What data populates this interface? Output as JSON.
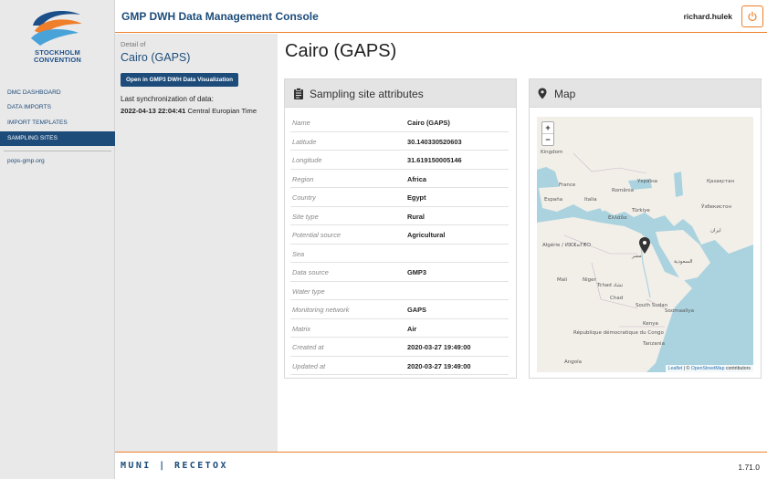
{
  "logo": {
    "line1": "STOCKHOLM",
    "line2": "CONVENTION"
  },
  "nav": {
    "items": [
      {
        "label": "DMC DASHBOARD"
      },
      {
        "label": "DATA IMPORTS"
      },
      {
        "label": "IMPORT TEMPLATES"
      },
      {
        "label": "SAMPLING SITES"
      }
    ],
    "active": "SAMPLING SITES",
    "external_link": "pops-gmp.org"
  },
  "header": {
    "title": "GMP DWH Data Management Console",
    "username": "richard.hulek",
    "logout_icon": "power-icon"
  },
  "detail": {
    "caption": "Detail of",
    "name": "Cairo (GAPS)",
    "open_button": "Open in GMP3 DWH Data Visualization",
    "sync_label": "Last synchronization of data:",
    "sync_datetime": "2022-04-13 22:04:41",
    "sync_timezone": "Central Europian Time"
  },
  "page_title": "Cairo (GAPS)",
  "attributes_card": {
    "title": "Sampling site attributes",
    "icon": "clipboard-icon",
    "rows": [
      {
        "key": "Name",
        "value": "Cairo (GAPS)"
      },
      {
        "key": "Latitude",
        "value": "30.140330520603"
      },
      {
        "key": "Longitude",
        "value": "31.619150005146"
      },
      {
        "key": "Region",
        "value": "Africa"
      },
      {
        "key": "Country",
        "value": "Egypt"
      },
      {
        "key": "Site type",
        "value": "Rural"
      },
      {
        "key": "Potential source",
        "value": "Agricultural"
      },
      {
        "key": "Sea",
        "value": ""
      },
      {
        "key": "Data source",
        "value": "GMP3"
      },
      {
        "key": "Water type",
        "value": ""
      },
      {
        "key": "Monitoring network",
        "value": "GAPS"
      },
      {
        "key": "Matrix",
        "value": "Air"
      },
      {
        "key": "Created at",
        "value": "2020-03-27 19:49:00"
      },
      {
        "key": "Updated at",
        "value": "2020-03-27 19:49:00"
      }
    ]
  },
  "map_card": {
    "title": "Map",
    "icon": "map-marker-icon",
    "zoom_in": "+",
    "zoom_out": "−",
    "attribution_leaflet": "Leaflet",
    "attribution_sep": " | © ",
    "attribution_osm": "OpenStreetMap",
    "attribution_tail": " contributors",
    "labels": [
      "Kingdom",
      "France",
      "España",
      "Italia",
      "România",
      "Україна",
      "Қазақстан",
      "Türkiye",
      "Ελλάδα",
      "Ўзбекистон",
      "Algérie / ⵍⵣⵣⴰⵢⴻⵔ",
      "Mali",
      "Niger",
      "Tchad تشاد",
      "السعودية",
      "مصر",
      "South Sudan",
      "Soomaaliya",
      "Kenya",
      "Tanzania",
      "République démocratique du Congo",
      "Angola",
      "ایران",
      "Chad"
    ],
    "marker_color": "#333333"
  },
  "footer": {
    "brand": "MUNI | RECETOX",
    "version": "1.71.0"
  },
  "colors": {
    "accent": "#ef7f2a",
    "primary": "#1d4c7a",
    "sidebar": "#e9e9e9"
  }
}
